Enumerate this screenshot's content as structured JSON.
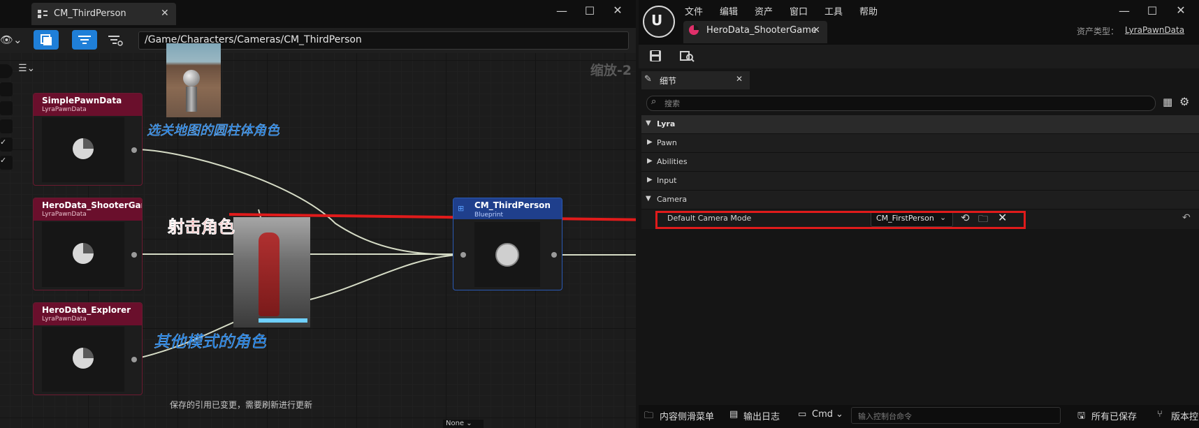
{
  "left_window": {
    "tab_title": "CM_ThirdPerson",
    "path": "/Game/Characters/Cameras/CM_ThirdPerson",
    "zoom_label": "缩放-2",
    "status_text": "保存的引用已变更，需要刷新进行更新",
    "bottom_combo": "None"
  },
  "nodes": [
    {
      "title": "SimplePawnData",
      "subtitle": "LyraPawnData"
    },
    {
      "title": "HeroData_ShooterGame",
      "subtitle": "LyraPawnData"
    },
    {
      "title": "HeroData_Explorer",
      "subtitle": "LyraPawnData"
    }
  ],
  "cm_node": {
    "title": "CM_ThirdPerson",
    "subtitle": "Blueprint"
  },
  "annotations": {
    "cylinder_role": "选关地图的圆柱体角色",
    "shooter_role": "射击角色",
    "other_roles": "其他模式的角色"
  },
  "right_window": {
    "menu": [
      "文件",
      "编辑",
      "资产",
      "窗口",
      "工具",
      "帮助"
    ],
    "tab_title": "HeroData_ShooterGame",
    "asset_type_label": "资产类型：",
    "asset_type_value": "LyraPawnData",
    "details_tab": "细节",
    "search_placeholder": "搜索",
    "categories": [
      "Lyra",
      "Pawn",
      "Abilities",
      "Input",
      "Camera"
    ],
    "property_label": "Default Camera Mode",
    "property_value": "CM_FirstPerson",
    "statusbar": {
      "content_drawer": "内容侧滑菜单",
      "output_log": "输出日志",
      "cmd": "Cmd",
      "cmd_placeholder": "输入控制台命令",
      "all_saved": "所有已保存",
      "version_control": "版本控"
    }
  }
}
